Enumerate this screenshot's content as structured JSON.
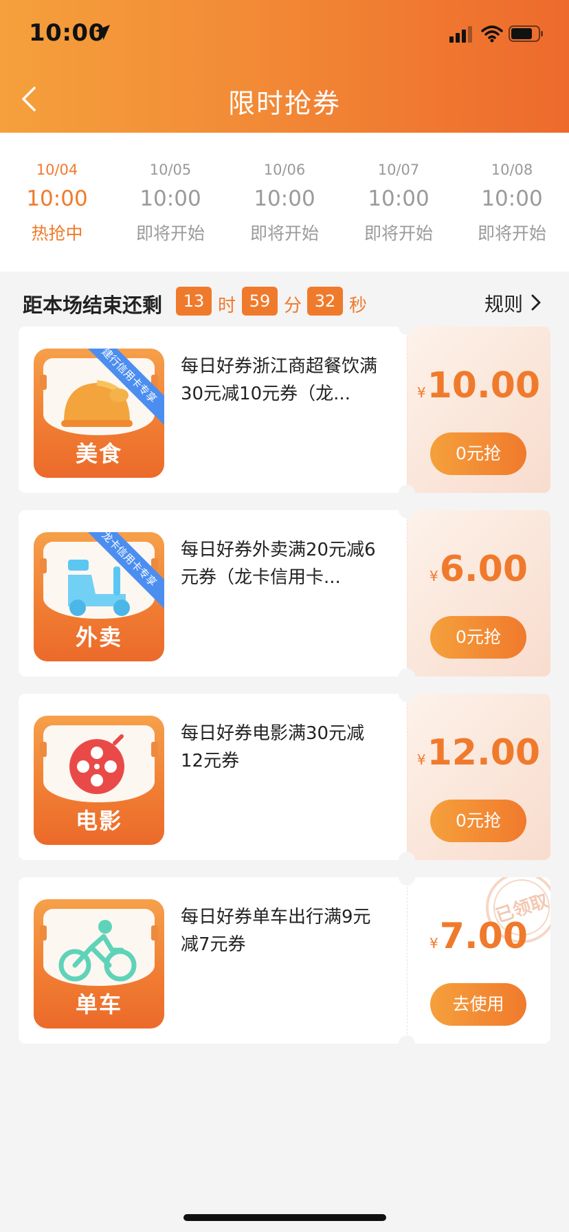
{
  "status_bar": {
    "time": "10:00"
  },
  "header": {
    "title": "限时抢券"
  },
  "tabs": [
    {
      "date": "10/04",
      "time": "10:00",
      "status": "热抢中"
    },
    {
      "date": "10/05",
      "time": "10:00",
      "status": "即将开始"
    },
    {
      "date": "10/06",
      "time": "10:00",
      "status": "即将开始"
    },
    {
      "date": "10/07",
      "time": "10:00",
      "status": "即将开始"
    },
    {
      "date": "10/08",
      "time": "10:00",
      "status": "即将开始"
    }
  ],
  "countdown": {
    "label": "距本场结束还剩",
    "hours": "13",
    "hours_unit": "时",
    "minutes": "59",
    "minutes_unit": "分",
    "seconds": "32",
    "seconds_unit": "秒",
    "rules_label": "规则"
  },
  "coupons": [
    {
      "category": "美食",
      "ribbon": "建行信用卡专享",
      "title": "每日好券浙江商超餐饮满30元减10元券（龙...",
      "currency": "¥",
      "price": "10.00",
      "button": "0元抢",
      "icon": "food-icon"
    },
    {
      "category": "外卖",
      "ribbon": "龙卡信用卡专享",
      "title": "每日好券外卖满20元减6元券（龙卡信用卡...",
      "currency": "¥",
      "price": "6.00",
      "button": "0元抢",
      "icon": "scooter-icon"
    },
    {
      "category": "电影",
      "title": "每日好券电影满30元减12元券",
      "currency": "¥",
      "price": "12.00",
      "button": "0元抢",
      "icon": "film-reel-icon"
    },
    {
      "category": "单车",
      "title": "每日好券单车出行满9元减7元券",
      "currency": "¥",
      "price": "7.00",
      "button": "去使用",
      "stamp": "已领取",
      "icon": "bicycle-icon"
    }
  ],
  "colors": {
    "accent": "#f07a2c",
    "ribbon": "#4c8ef0"
  }
}
